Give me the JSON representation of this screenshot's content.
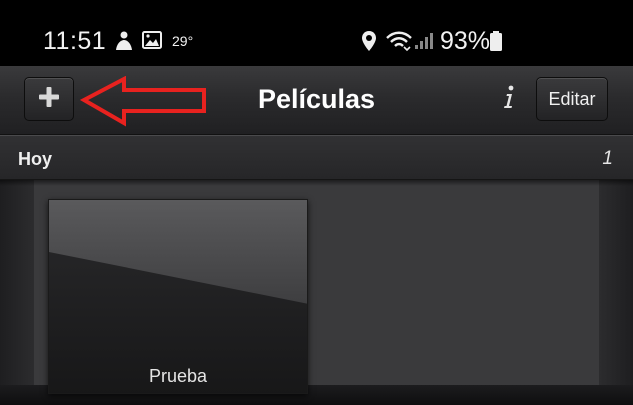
{
  "status_bar": {
    "time": "11:51",
    "temperature": "29°",
    "battery": "93%",
    "icons": [
      "user-icon",
      "image-icon",
      "location-icon",
      "wifi-icon",
      "signal-icon",
      "battery-icon"
    ]
  },
  "nav_bar": {
    "add_icon": "plus-icon",
    "title": "Películas",
    "info_icon": "info-icon",
    "edit_label": "Editar"
  },
  "section": {
    "title": "Hoy",
    "count": "1"
  },
  "items": [
    {
      "label": "Prueba"
    }
  ],
  "colors": {
    "annotation": "#e8221f",
    "nav_background": "#2b2b2d",
    "shelf_background": "#3a3a3c"
  }
}
